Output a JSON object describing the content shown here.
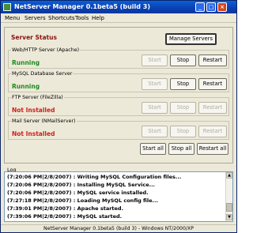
{
  "window": {
    "title": "NetServer Manager 0.1beta5 (build 3)",
    "controls": [
      "_",
      "□",
      "×"
    ]
  },
  "menu": [
    "Menu",
    "Servers",
    "Shortcuts",
    "Tools",
    "Help"
  ],
  "status": {
    "heading": "Server Status",
    "manage_label": "Manage Servers",
    "servers": [
      {
        "name": "Web/HTTP Server (Apache)",
        "state": "Running",
        "start": "Start",
        "stop": "Stop",
        "restart": "Restart"
      },
      {
        "name": "MySQL Database Server",
        "state": "Running",
        "start": "Start",
        "stop": "Stop",
        "restart": "Restart"
      },
      {
        "name": "FTP Server (FileZilla)",
        "state": "Not Installed",
        "start": "Start",
        "stop": "Stop",
        "restart": "Restart"
      },
      {
        "name": "Mail Server (NMailServer)",
        "state": "Not Installed",
        "start": "Start",
        "stop": "Stop",
        "restart": "Restart"
      }
    ],
    "start_all": "Start all",
    "stop_all": "Stop all",
    "restart_all": "Restart all"
  },
  "log": {
    "title": "Log",
    "lines": [
      "(7:20:06 PM|2/8/2007) : Writing MySQL Configuration files...",
      "(7:20:06 PM|2/8/2007) : Installing MySQL Service...",
      "(7:20:06 PM|2/8/2007) : MySQL service installed.",
      "(7:27:18 PM|2/8/2007) : Loading MySQL config file...",
      "(7:39:01 PM|2/8/2007) : Apache started.",
      "(7:39:06 PM|2/8/2007) : MySQL started."
    ]
  },
  "statusbar": "NetServer Manager 0.1beta5 (build 3) - Windows NT/2000/XP"
}
